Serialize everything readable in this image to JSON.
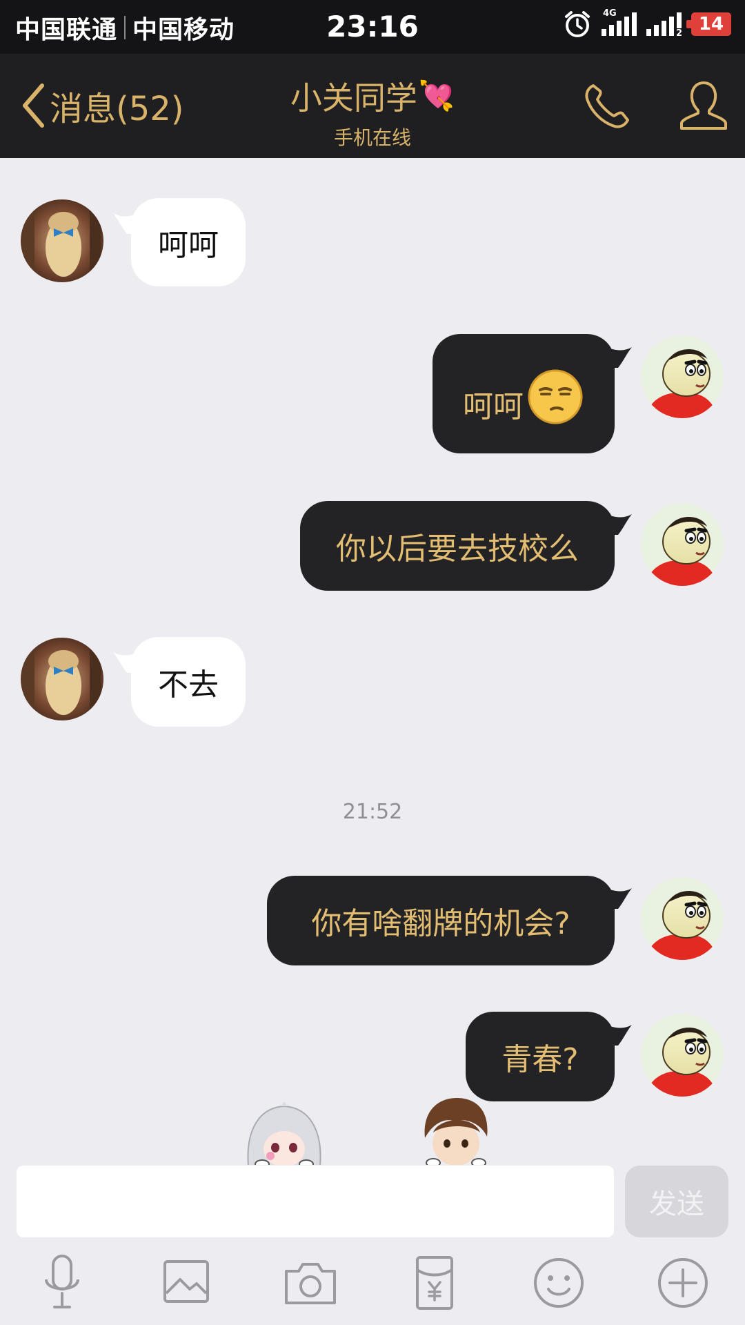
{
  "status_bar": {
    "carrier_1": "中国联通",
    "carrier_2": "中国移动",
    "time": "23:16",
    "network_type": "4G",
    "sim_2_label": "2",
    "battery": "14",
    "icons": [
      "alarm-clock-icon",
      "signal-icon",
      "signal-icon"
    ]
  },
  "nav": {
    "back_label": "消息(52)",
    "title": "小关同学",
    "title_emoji": "💘",
    "subtitle": "手机在线",
    "accent_color": "#d9b36a",
    "icons": [
      "chevron-left-icon",
      "phone-icon",
      "profile-icon"
    ]
  },
  "messages": [
    {
      "sender": "contact",
      "text": "呵呵"
    },
    {
      "sender": "me",
      "text": "呵呵",
      "emoji": "smirk-face-icon"
    },
    {
      "sender": "me",
      "text": "你以后要去技校么"
    },
    {
      "sender": "contact",
      "text": "不去"
    },
    {
      "type": "timestamp",
      "text": "21:52"
    },
    {
      "sender": "me",
      "text": "你有啥翻牌的机会?"
    },
    {
      "sender": "me",
      "text": "青春?"
    }
  ],
  "input": {
    "value": "",
    "send_label": "发送"
  },
  "toolbar": [
    "microphone-icon",
    "image-icon",
    "camera-icon",
    "red-packet-icon",
    "emoji-icon",
    "plus-icon"
  ],
  "colors": {
    "outgoing_bubble": "#232325",
    "outgoing_text": "#e2bd72",
    "incoming_bubble": "#ffffff",
    "background": "#ededf1"
  }
}
